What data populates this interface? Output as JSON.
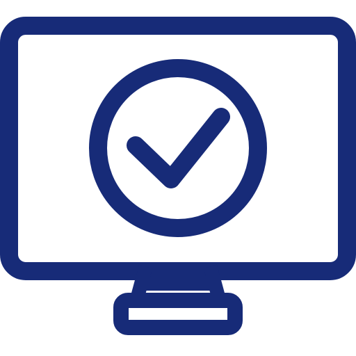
{
  "icon": {
    "name": "monitor-check-icon",
    "color": "#172b78",
    "background": "#ffffff"
  }
}
